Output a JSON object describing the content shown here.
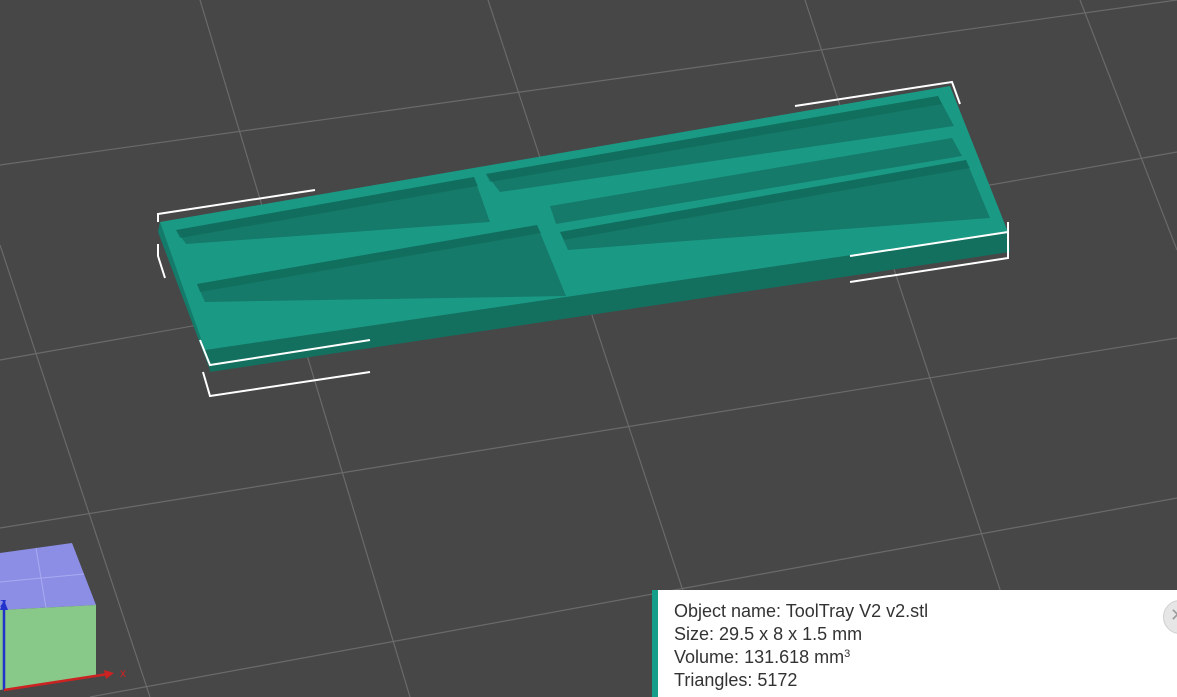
{
  "object_info": {
    "name_label": "Object name:",
    "name_value": "ToolTray V2 v2.stl",
    "size_label": "Size:",
    "size_value": "29.5 x 8 x 1.5 mm",
    "volume_label": "Volume:",
    "volume_value": "131.618 mm",
    "volume_unit_sup": "3",
    "triangles_label": "Triangles:",
    "triangles_value": "5172",
    "close_icon": "close-icon"
  },
  "view_cube": {
    "z_label": "z",
    "x_label": "x"
  },
  "colors": {
    "background": "#474747",
    "grid_line": "#6a6a6a",
    "model_top": "#1a9a85",
    "model_side": "#147a6a",
    "selection_bracket": "#ffffff",
    "panel_accent": "#159f8a",
    "cube_top": "#8c8ee6",
    "cube_side": "#88c888",
    "axis_z": "#2233cc",
    "axis_x": "#cc2222"
  }
}
